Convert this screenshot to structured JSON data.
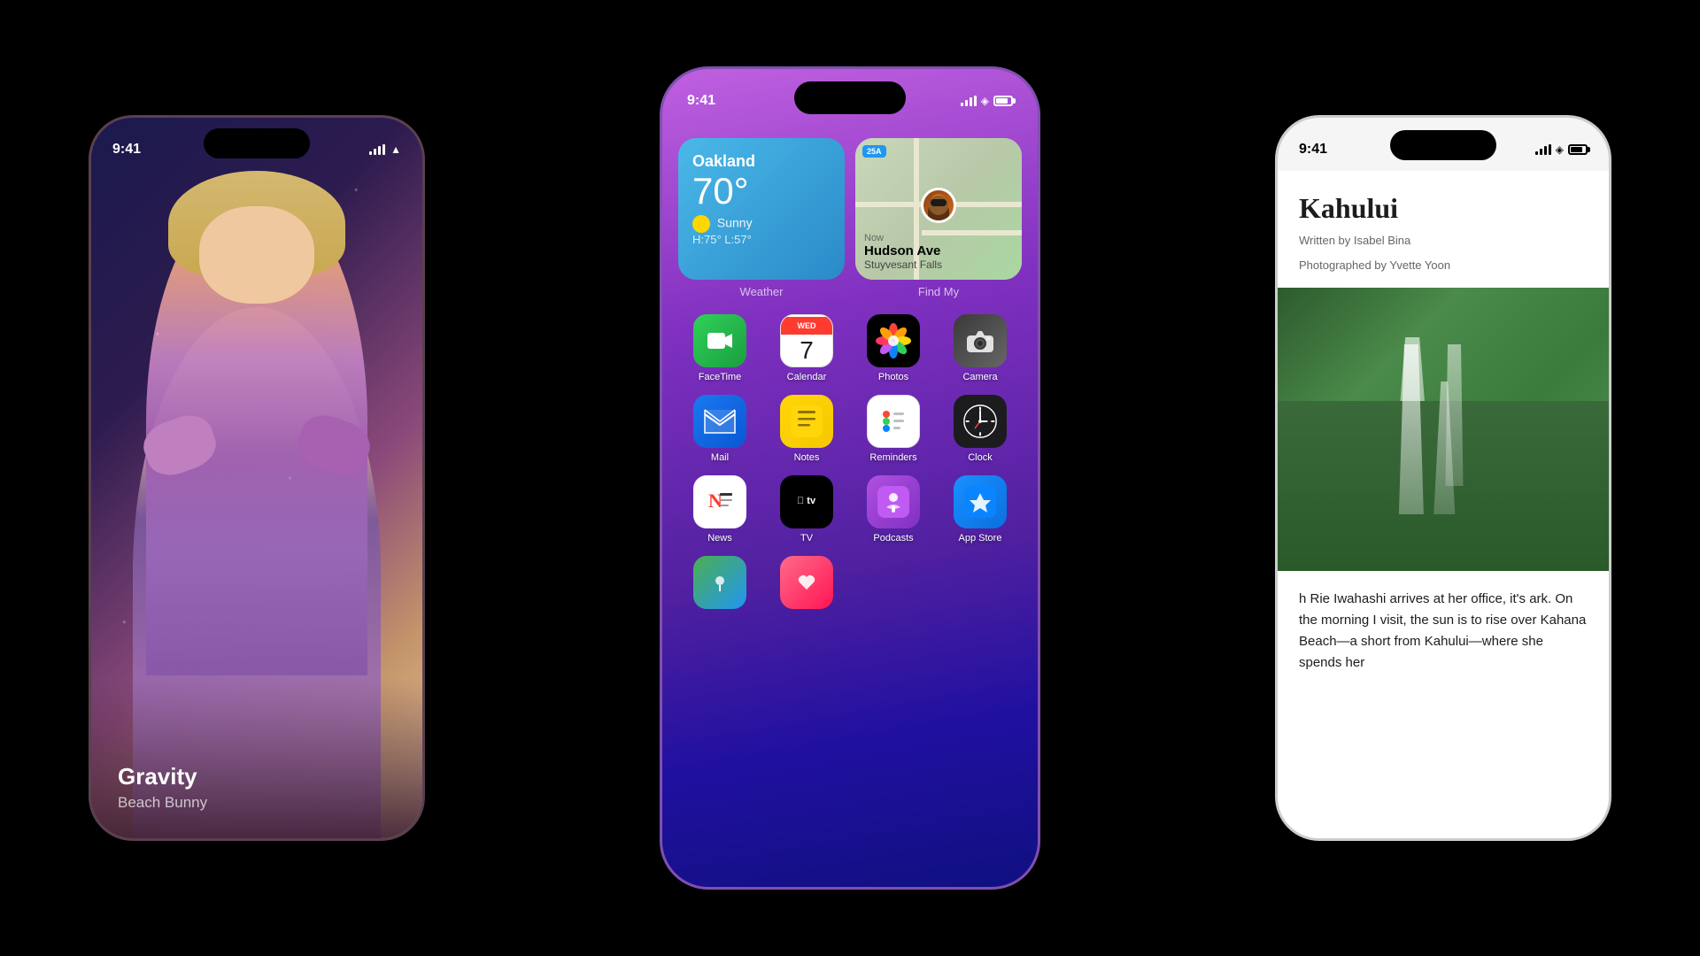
{
  "background": "#000000",
  "phones": {
    "left": {
      "time": "9:41",
      "nowPlaying": {
        "title": "Gravity",
        "artist": "Beach Bunny"
      }
    },
    "center": {
      "time": "9:41",
      "widgets": {
        "weather": {
          "city": "Oakland",
          "temp": "70°",
          "condition": "Sunny",
          "highLow": "H:75° L:57°",
          "label": "Weather"
        },
        "findmy": {
          "label": "Find My",
          "badge": "25A",
          "now": "Now",
          "street": "Hudson Ave",
          "city": "Stuyvesant Falls"
        }
      },
      "apps": [
        {
          "name": "FaceTime",
          "type": "facetime"
        },
        {
          "name": "Calendar",
          "type": "calendar",
          "day": "WED",
          "date": "7"
        },
        {
          "name": "Photos",
          "type": "photos"
        },
        {
          "name": "Camera",
          "type": "camera"
        },
        {
          "name": "Mail",
          "type": "mail"
        },
        {
          "name": "Notes",
          "type": "notes"
        },
        {
          "name": "Reminders",
          "type": "reminders"
        },
        {
          "name": "Clock",
          "type": "clock"
        },
        {
          "name": "News",
          "type": "news"
        },
        {
          "name": "TV",
          "type": "tv"
        },
        {
          "name": "Podcasts",
          "type": "podcasts"
        },
        {
          "name": "App Store",
          "type": "appstore"
        }
      ]
    },
    "right": {
      "time": "9:41",
      "article": {
        "title": "Kahului",
        "writtenBy": "Written by Isabel Bina",
        "photographedBy": "Photographed by Yvette Yoon",
        "text": "h Rie Iwahashi arrives at her office, it's ark. On the morning I visit, the sun is to rise over Kahana Beach—a short from Kahului—where she spends her"
      }
    }
  }
}
